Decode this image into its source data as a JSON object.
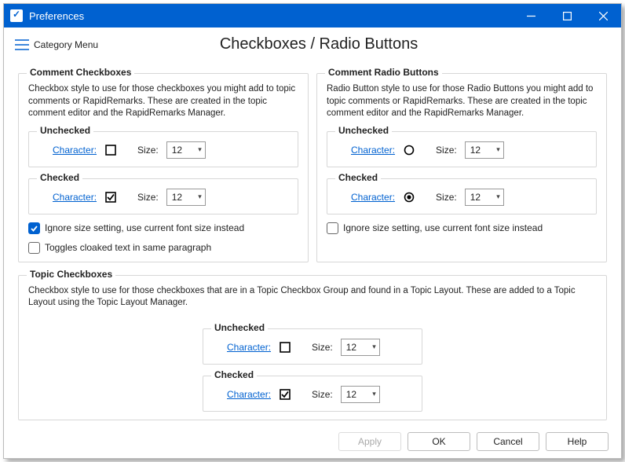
{
  "window": {
    "title": "Preferences"
  },
  "header": {
    "menu_label": "Category Menu",
    "page_title": "Checkboxes / Radio Buttons"
  },
  "labels": {
    "character": "Character:",
    "size": "Size:",
    "unchecked": "Unchecked",
    "checked": "Checked"
  },
  "comment_checkboxes": {
    "legend": "Comment Checkboxes",
    "desc": "Checkbox style to use for those checkboxes you might add to topic comments or RapidRemarks.  These are created in the topic comment editor and the RapidRemarks Manager.",
    "unchecked_size": "12",
    "checked_size": "12",
    "ignore_label": "Ignore size setting, use current font size instead",
    "ignore_checked": true,
    "toggle_label": "Toggles cloaked text in same paragraph",
    "toggle_checked": false
  },
  "comment_radios": {
    "legend": "Comment Radio Buttons",
    "desc": "Radio Button style to use for those Radio Buttons you might add to topic comments or RapidRemarks.  These are created in the topic comment editor and the RapidRemarks Manager.",
    "unchecked_size": "12",
    "checked_size": "12",
    "ignore_label": "Ignore size setting, use current font size instead",
    "ignore_checked": false
  },
  "topic_checkboxes": {
    "legend": "Topic Checkboxes",
    "desc": "Checkbox style to use for those checkboxes that are in a Topic Checkbox Group and found in a Topic Layout.  These are added to a Topic Layout using the Topic Layout Manager.",
    "unchecked_size": "12",
    "checked_size": "12"
  },
  "footer": {
    "apply": "Apply",
    "ok": "OK",
    "cancel": "Cancel",
    "help": "Help"
  }
}
